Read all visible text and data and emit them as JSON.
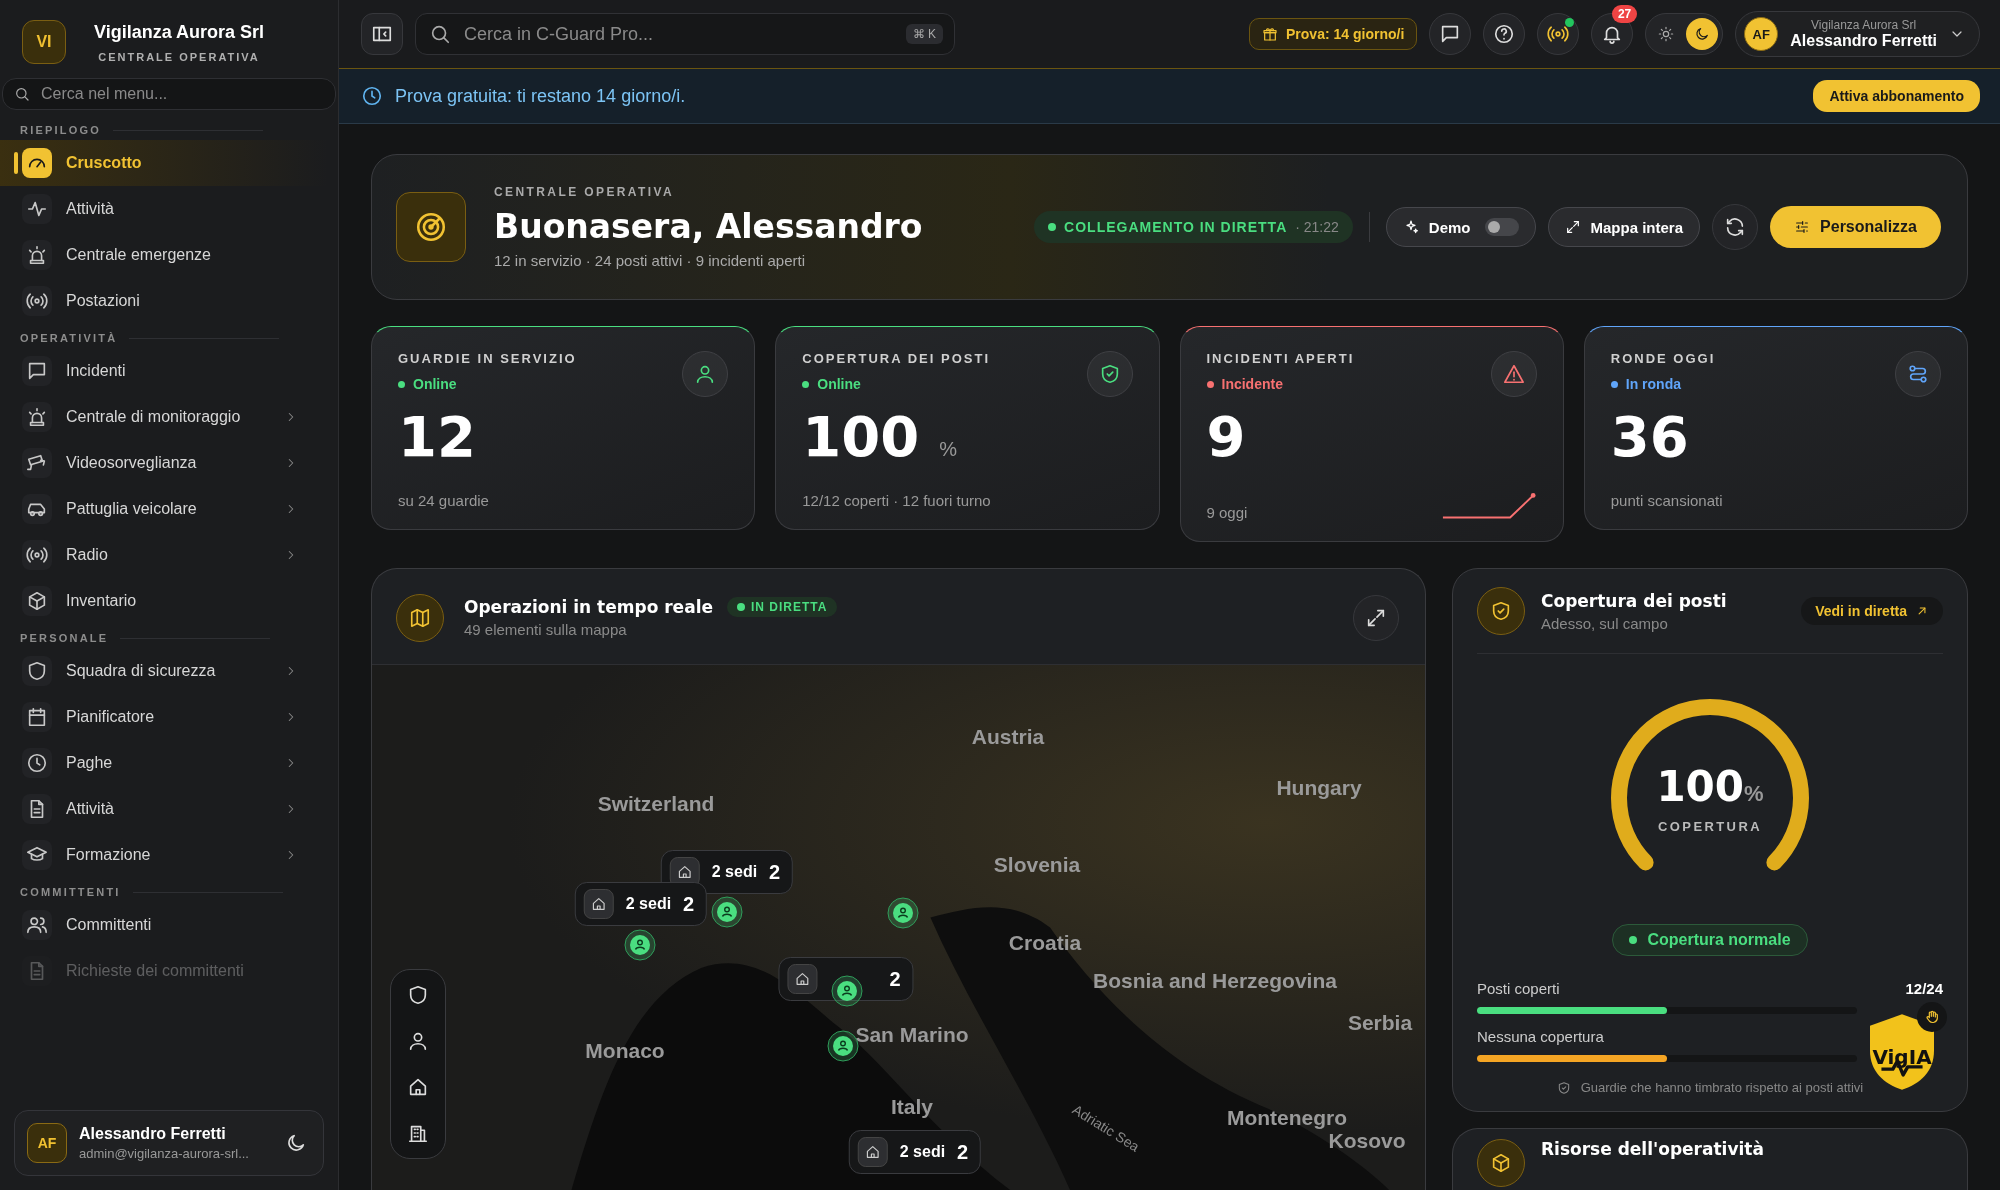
{
  "sidebar": {
    "logo": "VI",
    "org": "Vigilanza Aurora Srl",
    "subtitle": "CENTRALE OPERATIVA",
    "search": {
      "placeholder": "Cerca nel menu..."
    },
    "sections": [
      {
        "title": "RIEPILOGO",
        "items": [
          {
            "label": "Cruscotto",
            "selected": true,
            "expandable": false
          },
          {
            "label": "Attività",
            "selected": false,
            "expandable": false
          },
          {
            "label": "Centrale emergenze",
            "selected": false,
            "expandable": false
          },
          {
            "label": "Postazioni",
            "selected": false,
            "expandable": false
          }
        ]
      },
      {
        "title": "OPERATIVITÀ",
        "items": [
          {
            "label": "Incidenti",
            "selected": false,
            "expandable": false
          },
          {
            "label": "Centrale di monitoraggio",
            "selected": false,
            "expandable": true
          },
          {
            "label": "Videosorveglianza",
            "selected": false,
            "expandable": true
          },
          {
            "label": "Pattuglia veicolare",
            "selected": false,
            "expandable": true
          },
          {
            "label": "Radio",
            "selected": false,
            "expandable": true
          },
          {
            "label": "Inventario",
            "selected": false,
            "expandable": false
          }
        ]
      },
      {
        "title": "PERSONALE",
        "items": [
          {
            "label": "Squadra di sicurezza",
            "selected": false,
            "expandable": true
          },
          {
            "label": "Pianificatore",
            "selected": false,
            "expandable": true
          },
          {
            "label": "Paghe",
            "selected": false,
            "expandable": true
          },
          {
            "label": "Attività",
            "selected": false,
            "expandable": true
          },
          {
            "label": "Formazione",
            "selected": false,
            "expandable": true
          }
        ]
      },
      {
        "title": "COMMITTENTI",
        "items": [
          {
            "label": "Committenti",
            "selected": false,
            "expandable": false
          },
          {
            "label": "Richieste dei committenti",
            "selected": false,
            "expandable": false,
            "dimmed": true
          }
        ]
      }
    ],
    "user": {
      "initials": "AF",
      "name": "Alessandro Ferretti",
      "email": "admin@vigilanza-aurora-srl..."
    }
  },
  "topbar": {
    "search": {
      "placeholder": "Cerca in C-Guard Pro...",
      "shortcut": "⌘ K"
    },
    "trial": "Prova: 14 giorno/i",
    "radio_online": true,
    "notifications": "27",
    "theme": [
      {
        "kind": "light",
        "selected": false
      },
      {
        "kind": "dark",
        "selected": true
      }
    ],
    "user": {
      "initials": "AF",
      "org": "Vigilanza Aurora Srl",
      "name": "Alessandro Ferretti"
    }
  },
  "banner": {
    "text": "Prova gratuita: ti restano 14 giorno/i.",
    "button": "Attiva abbonamento"
  },
  "hero": {
    "eyebrow": "CENTRALE OPERATIVA",
    "title": "Buonasera, Alessandro",
    "subtitle": "12 in servizio · 24 posti attivi · 9 incidenti aperti",
    "live": "COLLEGAMENTO IN DIRETTA",
    "time": "· 21:22",
    "demo": {
      "label": "Demo",
      "on": false
    },
    "map_button": "Mappa intera",
    "customize_button": "Personalizza"
  },
  "stats": [
    {
      "title": "GUARDIE IN SERVIZIO",
      "status": "Online",
      "color": "#4ade80",
      "value": "12",
      "footnote": "su 24 guardie",
      "sparkline": false
    },
    {
      "title": "COPERTURA DEI POSTI",
      "status": "Online",
      "color": "#4ade80",
      "value": "100",
      "unit": "%",
      "footnote": "12/12 coperti · 12 fuori turno",
      "sparkline": false
    },
    {
      "title": "INCIDENTI APERTI",
      "status": "Incidente",
      "color": "#f87171",
      "value": "9",
      "footnote": "9 oggi",
      "sparkline": true
    },
    {
      "title": "RONDE OGGI",
      "status": "In ronda",
      "color": "#60a5fa",
      "value": "36",
      "footnote": "punti scansionati",
      "sparkline": false
    }
  ],
  "map_panel": {
    "title": "Operazioni in tempo reale",
    "live": "IN DIRETTA",
    "subtitle": "49 elementi sulla mappa",
    "labels": [
      {
        "text": "Austria",
        "kind": "country"
      },
      {
        "text": "Hungary",
        "kind": "country"
      },
      {
        "text": "Switzerland",
        "kind": "country"
      },
      {
        "text": "Slovenia",
        "kind": "country"
      },
      {
        "text": "Croatia",
        "kind": "country"
      },
      {
        "text": "Bosnia and Herzegovina",
        "kind": "country"
      },
      {
        "text": "Serbia",
        "kind": "country"
      },
      {
        "text": "Monaco",
        "kind": "country"
      },
      {
        "text": "San Marino",
        "kind": "country"
      },
      {
        "text": "Italy",
        "kind": "country"
      },
      {
        "text": "Montenegro",
        "kind": "country"
      },
      {
        "text": "Kosovo",
        "kind": "country"
      },
      {
        "text": "Adriatic Sea",
        "kind": "sea"
      }
    ],
    "clusters": [
      {
        "label": "2 sedi",
        "count": "2"
      },
      {
        "label": "2 sedi",
        "count": "2"
      },
      {
        "count": "2"
      },
      {
        "label": "2 sedi",
        "count": "2"
      }
    ]
  },
  "coverage_panel": {
    "title": "Copertura dei posti",
    "subtitle": "Adesso, sul campo",
    "link": "Vedi in diretta",
    "gauge": {
      "value": "100",
      "unit": "%",
      "caption": "COPERTURA",
      "level": 1
    },
    "status": "Copertura normale",
    "count": "12/24",
    "bars": [
      {
        "label": "Posti coperti",
        "level": 0.5,
        "color": "#4ade80"
      },
      {
        "label": "Nessuna copertura",
        "level": 0.5,
        "color": "#f5a524"
      }
    ],
    "note": "Guardie che hanno timbrato rispetto ai posti attivi",
    "assistant": "VigIA"
  },
  "resources_panel": {
    "title": "Risorse dell'operatività"
  }
}
